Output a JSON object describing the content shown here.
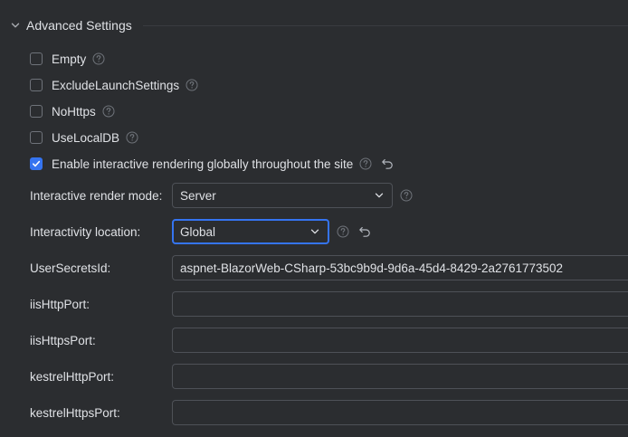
{
  "section": {
    "title": "Advanced Settings",
    "expanded": true
  },
  "checkboxes": [
    {
      "label": "Empty",
      "checked": false,
      "has_help": true,
      "has_reset": false
    },
    {
      "label": "ExcludeLaunchSettings",
      "checked": false,
      "has_help": true,
      "has_reset": false
    },
    {
      "label": "NoHttps",
      "checked": false,
      "has_help": true,
      "has_reset": false
    },
    {
      "label": "UseLocalDB",
      "checked": false,
      "has_help": true,
      "has_reset": false
    },
    {
      "label": "Enable interactive rendering globally throughout the site",
      "checked": true,
      "has_help": true,
      "has_reset": true
    }
  ],
  "fields": {
    "render_mode": {
      "label": "Interactive render mode:",
      "value": "Server"
    },
    "interactivity_location": {
      "label": "Interactivity location:",
      "value": "Global"
    },
    "user_secrets_id": {
      "label": "UserSecretsId:",
      "value": "aspnet-BlazorWeb-CSharp-53bc9b9d-9d6a-45d4-8429-2a2761773502"
    },
    "iis_http_port": {
      "label": "iisHttpPort:",
      "value": ""
    },
    "iis_https_port": {
      "label": "iisHttpsPort:",
      "value": ""
    },
    "kestrel_http_port": {
      "label": "kestrelHttpPort:",
      "value": ""
    },
    "kestrel_https_port": {
      "label": "kestrelHttpsPort:",
      "value": ""
    }
  },
  "colors": {
    "background": "#2b2d30",
    "text": "#dfe1e5",
    "accent": "#3574f0",
    "border": "#4e5157",
    "icon_muted": "#6f737a"
  },
  "icons": {
    "chevron": "chevron-down-icon",
    "help": "help-icon",
    "reset": "reset-icon",
    "check": "checkmark-icon",
    "dropdown": "chevron-down-icon"
  }
}
